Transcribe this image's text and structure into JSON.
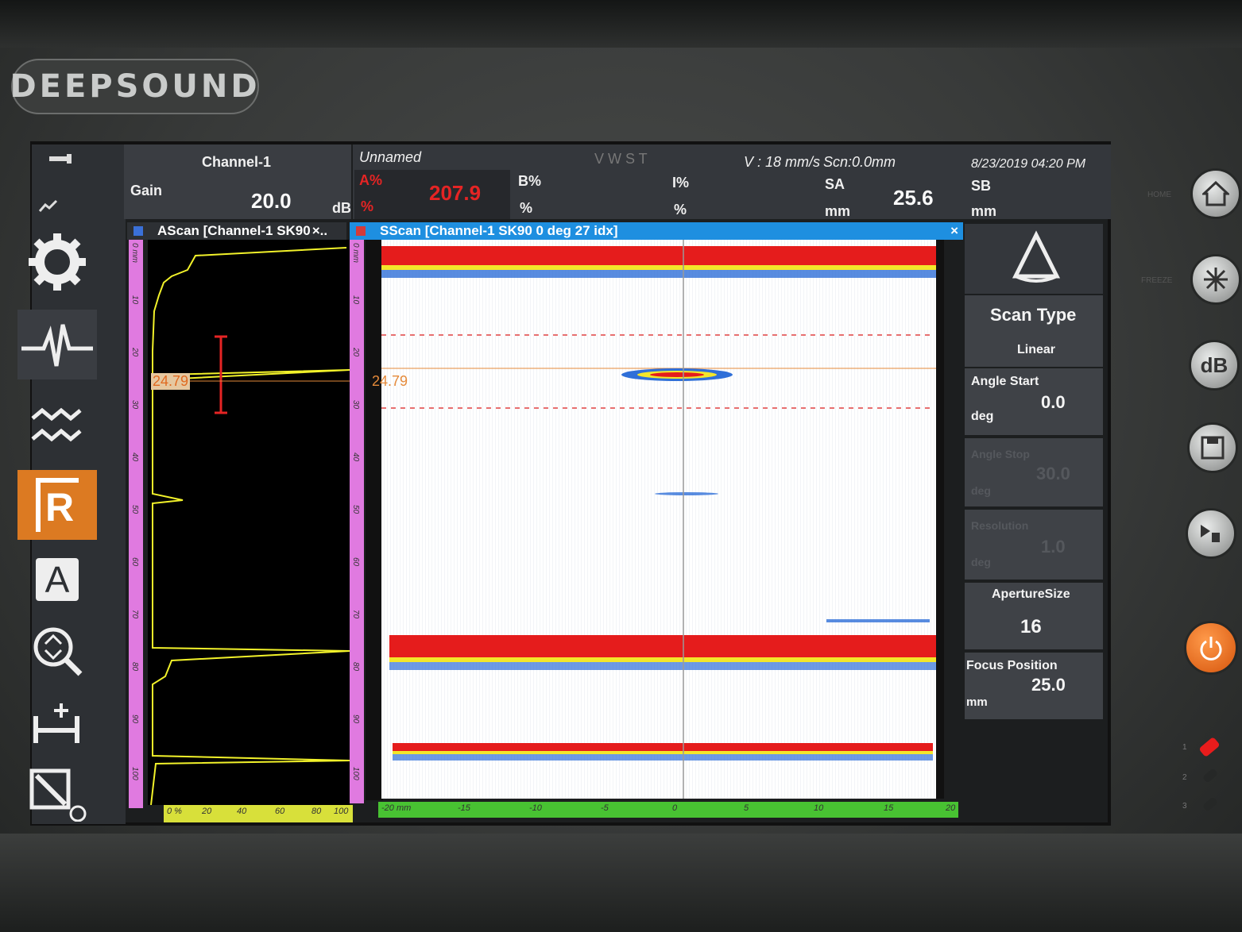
{
  "device": {
    "brand": "DEEPSOUND",
    "home_label": "HOME",
    "freeze_label": "FREEZE"
  },
  "header": {
    "channel": "Channel-1",
    "gain_label": "Gain",
    "gain_value": "20.0",
    "gain_unit": "dB",
    "setup_name": "Unnamed",
    "status_flags": "V W S T",
    "velocity": "V : 18 mm/s",
    "scan_position": "Scn:0.0mm",
    "datetime": "8/23/2019 04:20 PM",
    "a_label": "A%",
    "a_unit": "%",
    "a_value": "207.9",
    "b_label": "B%",
    "b_unit": "%",
    "i_label": "I%",
    "i_unit": "%",
    "sa_label": "SA",
    "sa_unit": "mm",
    "sa_value": "25.6",
    "sb_label": "SB",
    "sb_unit": "mm"
  },
  "ascan": {
    "title": "AScan [Channel-1 SK90",
    "close_glyph": "×..",
    "cursor_value": "24.79",
    "depth_ticks": [
      "0 mm",
      "10",
      "20",
      "30",
      "40",
      "50",
      "60",
      "70",
      "80",
      "90",
      "100"
    ],
    "amp_ticks": [
      "0 %",
      "20",
      "40",
      "60",
      "80",
      "100"
    ]
  },
  "sscan": {
    "title": "SScan [Channel-1 SK90 0 deg 27 idx]",
    "close_glyph": "×",
    "cursor_value": "24.79",
    "depth_ticks": [
      "0 mm",
      "10",
      "20",
      "30",
      "40",
      "50",
      "60",
      "70",
      "80",
      "90",
      "100"
    ],
    "scan_ticks": [
      "-20 mm",
      "-15",
      "-10",
      "-5",
      "0",
      "5",
      "10",
      "15",
      "20"
    ]
  },
  "params": {
    "scan_type_label": "Scan Type",
    "scan_type_value": "Linear",
    "angle_start_label": "Angle Start",
    "angle_start_value": "0.0",
    "angle_start_unit": "deg",
    "angle_stop_label": "Angle Stop",
    "angle_stop_value": "30.0",
    "angle_stop_unit": "deg",
    "resolution_label": "Resolution",
    "resolution_value": "1.0",
    "resolution_unit": "deg",
    "aperture_label": "ApertureSize",
    "aperture_value": "16",
    "focus_label": "Focus Position",
    "focus_value": "25.0",
    "focus_unit": "mm"
  },
  "toolbar": {
    "r_label": "R",
    "a_label": "A"
  },
  "hw_buttons": {
    "db_label": "dB"
  },
  "leds": [
    "1",
    "2",
    "3"
  ],
  "colors": {
    "accent_orange": "#dc7a22",
    "panel_blue": "#1e8fe0",
    "echo_red": "#e51c1c",
    "ruler_pink": "#e07ae0",
    "ruler_green": "#48c232",
    "trace_yellow": "#f2f22a"
  }
}
